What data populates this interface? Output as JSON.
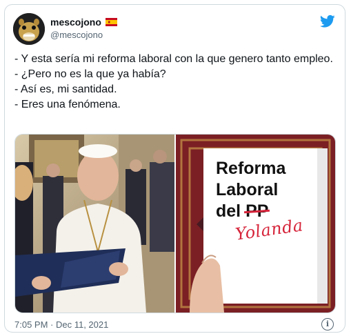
{
  "author": {
    "name": "mescojono",
    "handle": "@mescojono",
    "flag_icon": "spain-flag-icon"
  },
  "tweet": {
    "lines": [
      "- Y esta sería mi reforma laboral con la que genero tanto empleo.",
      "- ¿Pero no es la que ya había?",
      "- Así es, mi santidad.",
      "- Eres una fenómena."
    ],
    "timestamp": "7:05 PM · Dec 11, 2021"
  },
  "media": {
    "document": {
      "line1": "Reforma",
      "line2": "Laboral",
      "line3_prefix": "del ",
      "line3_struck": "PP",
      "handwritten": "Yolanda"
    }
  },
  "colors": {
    "brand_blue": "#1d9bf0",
    "strike_red": "#d6243a",
    "text": "#0f1419",
    "muted": "#536471"
  }
}
